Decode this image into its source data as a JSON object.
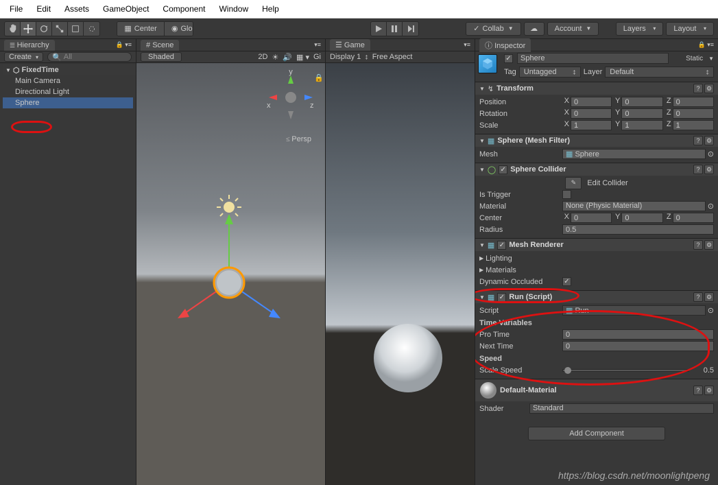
{
  "menu": [
    "File",
    "Edit",
    "Assets",
    "GameObject",
    "Component",
    "Window",
    "Help"
  ],
  "toolbar": {
    "center": "Center",
    "global": "Global",
    "collab": "Collab",
    "account": "Account",
    "layers": "Layers",
    "layout": "Layout"
  },
  "hierarchy": {
    "title": "Hierarchy",
    "create": "Create",
    "search_placeholder": "All",
    "scene": "FixedTime",
    "items": [
      "Main Camera",
      "Directional Light",
      "Sphere"
    ]
  },
  "scene": {
    "title": "Scene",
    "shading": "Shaded",
    "mode_2d": "2D",
    "gizmo_toggle": "Gi",
    "persp": "Persp"
  },
  "game": {
    "title": "Game",
    "display": "Display 1",
    "aspect": "Free Aspect"
  },
  "inspector": {
    "title": "Inspector",
    "object_name": "Sphere",
    "static_label": "Static",
    "tag_label": "Tag",
    "tag_value": "Untagged",
    "layer_label": "Layer",
    "layer_value": "Default",
    "transform": {
      "title": "Transform",
      "position": {
        "label": "Position",
        "x": "0",
        "y": "0",
        "z": "0"
      },
      "rotation": {
        "label": "Rotation",
        "x": "0",
        "y": "0",
        "z": "0"
      },
      "scale": {
        "label": "Scale",
        "x": "1",
        "y": "1",
        "z": "1"
      }
    },
    "mesh_filter": {
      "title": "Sphere (Mesh Filter)",
      "mesh_label": "Mesh",
      "mesh_value": "Sphere"
    },
    "collider": {
      "title": "Sphere Collider",
      "edit": "Edit Collider",
      "is_trigger": "Is Trigger",
      "material_label": "Material",
      "material_value": "None (Physic Material)",
      "center_label": "Center",
      "center": {
        "x": "0",
        "y": "0",
        "z": "0"
      },
      "radius_label": "Radius",
      "radius": "0.5"
    },
    "renderer": {
      "title": "Mesh Renderer",
      "lighting": "Lighting",
      "materials": "Materials",
      "dynamic_occluded": "Dynamic Occluded"
    },
    "script": {
      "title": "Run (Script)",
      "script_label": "Script",
      "script_value": "Run",
      "time_header": "Time Variables",
      "pro_time_label": "Pro Time",
      "pro_time": "0",
      "next_time_label": "Next Time",
      "next_time": "0",
      "speed_header": "Speed",
      "scale_speed_label": "Scale Speed",
      "scale_speed": "0.5"
    },
    "material": {
      "title": "Default-Material",
      "shader_label": "Shader",
      "shader_value": "Standard"
    },
    "add_component": "Add Component"
  },
  "watermark": "https://blog.csdn.net/moonlightpeng"
}
